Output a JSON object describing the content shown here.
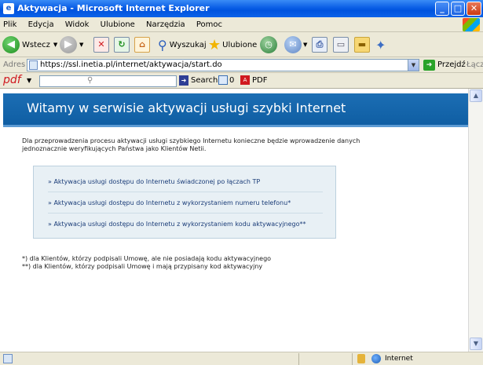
{
  "window": {
    "title": "Aktywacja - Microsoft Internet Explorer",
    "min": "_",
    "max": "□",
    "close": "✕"
  },
  "menu": [
    "Plik",
    "Edycja",
    "Widok",
    "Ulubione",
    "Narzędzia",
    "Pomoc"
  ],
  "toolbar": {
    "back_label": "Wstecz",
    "search_label": "Wyszukaj",
    "favorites_label": "Ulubione"
  },
  "address": {
    "label": "Adres",
    "url": "https://ssl.inetia.pl/internet/aktywacja/start.do",
    "go_label": "Przejdź",
    "links_label": "Łącza"
  },
  "pdfbar": {
    "logo": "pdf",
    "search_label": "Search",
    "count": "0",
    "pdf_label": "PDF"
  },
  "page": {
    "banner_title": "Witamy w serwisie aktywacji usługi szybki Internet",
    "intro": "Dla przeprowadzenia procesu aktywacji usługi szybkiego Internetu konieczne będzie wprowadzenie danych jednoznacznie weryfikujących Państwa jako Klientów Netii.",
    "links": [
      "» Aktywacja usługi dostępu do Internetu świadczonej po łączach TP",
      "» Aktywacja usługi dostępu do Internetu z wykorzystaniem numeru telefonu*",
      "» Aktywacja usługi dostępu do Internetu z wykorzystaniem kodu aktywacyjnego**"
    ],
    "footnotes": [
      "*) dla Klientów, którzy podpisali Umowę, ale nie posiadają kodu aktywacyjnego",
      "**) dla Klientów, którzy podpisali Umowę i mają przypisany kod aktywacyjny"
    ]
  },
  "status": {
    "zone": "Internet"
  },
  "colors": {
    "banner": "#1c6eb4",
    "linkbox": "#e8f0f5",
    "link_text": "#1a3c78"
  }
}
